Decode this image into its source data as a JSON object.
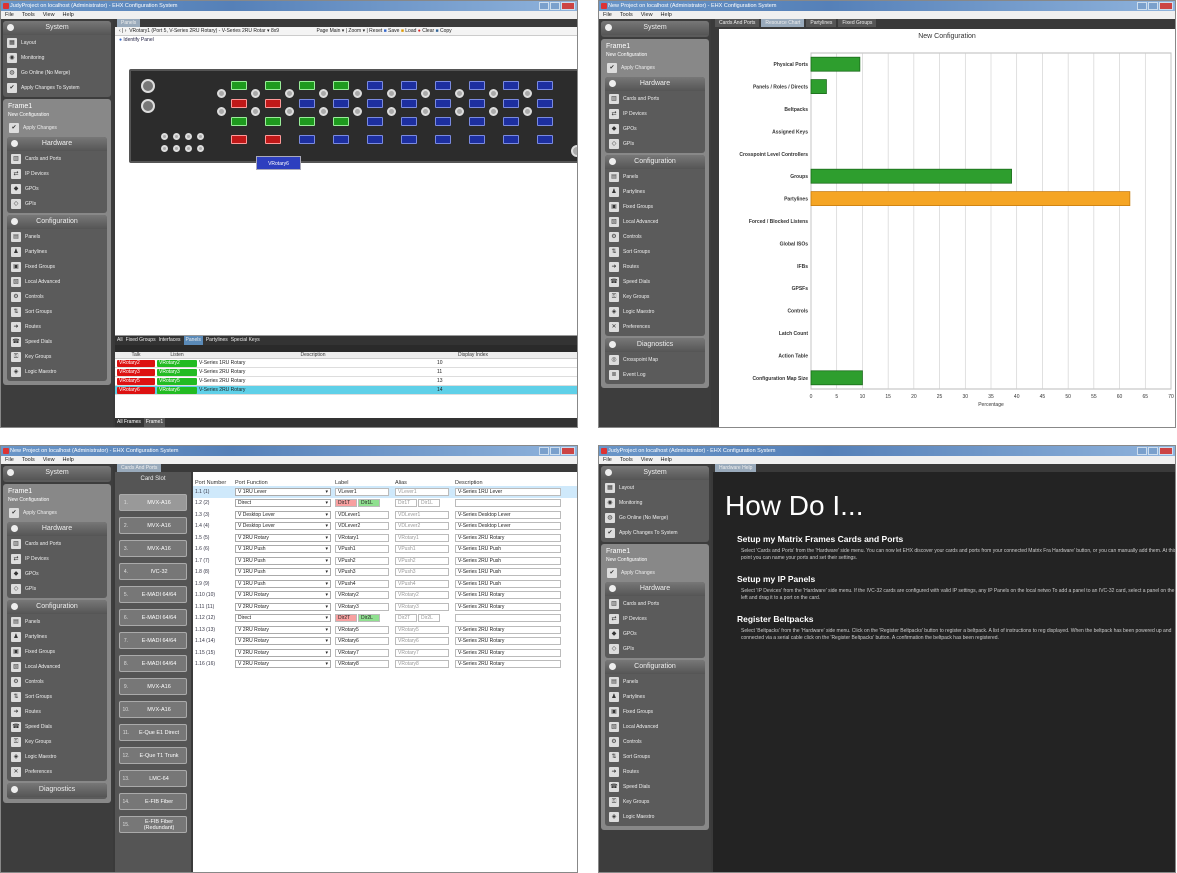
{
  "win1": {
    "title": "JudyProject on localhost (Administrator) - EHX Configuration System",
    "menu": [
      "File",
      "Tools",
      "View",
      "Help"
    ],
    "system": {
      "header": "System",
      "items": [
        "Layout",
        "Monitoring",
        "Go Online (No Merge)",
        "Apply Changes To System"
      ]
    },
    "frame": {
      "title": "Frame1",
      "subtitle": "New Configuration",
      "apply": "Apply Changes"
    },
    "hardware": {
      "header": "Hardware",
      "items": [
        "Cards and Ports",
        "IP Devices",
        "GPOs",
        "GPIs"
      ]
    },
    "configuration": {
      "header": "Configuration",
      "items": [
        "Panels",
        "Partylines",
        "Fixed Groups",
        "Local Advanced",
        "Controls",
        "Sort Groups",
        "Routes",
        "Speed Dials",
        "Key Groups",
        "Logic Maestro"
      ]
    },
    "tab": "Panels",
    "toolbar": {
      "combo": "VRotary1   (Port 5, V-Series 2RU Rotary)  - V-Series 2RU Rotar",
      "size": "8x9",
      "page": "Page Main",
      "zoom": "Zoom",
      "reset": "Reset",
      "save": "Save",
      "load": "Load",
      "clear": "Clear",
      "copy": "Copy"
    },
    "identify": "Identify Panel",
    "panel_label": "VRotary6",
    "grid": {
      "tabs": [
        "All",
        "Fixed Groups",
        "Interfaces",
        "Panels",
        "Partylines",
        "Special Keys"
      ],
      "active": "Panels",
      "headers": [
        "Talk",
        "Listen",
        "Description",
        "Display Index"
      ],
      "rows": [
        {
          "talk": "VRotary2",
          "listen": "VRotary2",
          "desc": "V-Series 1RU Rotary",
          "idx": "10"
        },
        {
          "talk": "VRotary3",
          "listen": "VRotary3",
          "desc": "V-Series 2RU Rotary",
          "idx": "11"
        },
        {
          "talk": "VRotary5",
          "listen": "VRotary5",
          "desc": "V-Series 2RU Rotary",
          "idx": "13"
        },
        {
          "talk": "VRotary6",
          "listen": "VRotary6",
          "desc": "V-Series 2RU Rotary",
          "idx": "14"
        }
      ]
    },
    "bottom": [
      "All Frames",
      "Frame1"
    ]
  },
  "win2": {
    "title": "New Project on localhost (Administrator) - EHX Configuration System",
    "menu": [
      "File",
      "Tools",
      "View",
      "Help"
    ],
    "system": {
      "header": "System"
    },
    "frame": {
      "title": "Frame1",
      "subtitle": "New Configuration",
      "apply": "Apply Changes"
    },
    "hardware": {
      "header": "Hardware",
      "items": [
        "Cards and Ports",
        "IP Devices",
        "GPOs",
        "GPIs"
      ]
    },
    "configuration": {
      "header": "Configuration",
      "items": [
        "Panels",
        "Partylines",
        "Fixed Groups",
        "Local Advanced",
        "Controls",
        "Sort Groups",
        "Routes",
        "Speed Dials",
        "Key Groups",
        "Logic Maestro",
        "Preferences"
      ]
    },
    "diagnostics": {
      "header": "Diagnostics",
      "items": [
        "Crosspoint Map",
        "Event Log"
      ]
    },
    "tabs": [
      "Cards And Ports",
      "Resource Chart",
      "Partylines",
      "Fixed Groups"
    ],
    "active_tab": "Resource Chart"
  },
  "chart_data": {
    "type": "bar",
    "orientation": "horizontal",
    "title": "New Configuration",
    "xlabel": "Percentage",
    "xlim": [
      0,
      70
    ],
    "xticks": [
      0,
      5,
      10,
      15,
      20,
      25,
      30,
      35,
      40,
      45,
      50,
      55,
      60,
      65,
      70
    ],
    "categories": [
      "Physical Ports",
      "Panels / Roles / Directs",
      "Beltpacks",
      "Assigned Keys",
      "Crosspoint Level Controllers",
      "Groups",
      "Partylines",
      "Forced / Blocked Listens",
      "Global ISOs",
      "IFBs",
      "GPSFs",
      "Controls",
      "Latch Count",
      "Action Table",
      "Configuration Map Size"
    ],
    "values": [
      9.5,
      3,
      0,
      0,
      0,
      39,
      62,
      0,
      0,
      0,
      0,
      0,
      0,
      0,
      10
    ],
    "colors": {
      "green": "#2e9e2e",
      "orange": "#f5a524"
    }
  },
  "win3": {
    "title": "New Project on localhost (Administrator) - EHX Configuration System",
    "menu": [
      "File",
      "Tools",
      "View",
      "Help"
    ],
    "system": {
      "header": "System"
    },
    "frame": {
      "title": "Frame1",
      "subtitle": "New Configuration",
      "apply": "Apply Changes"
    },
    "hardware": {
      "header": "Hardware",
      "items": [
        "Cards and Ports",
        "IP Devices",
        "GPOs",
        "GPIs"
      ]
    },
    "configuration": {
      "header": "Configuration",
      "items": [
        "Panels",
        "Partylines",
        "Fixed Groups",
        "Local Advanced",
        "Controls",
        "Sort Groups",
        "Routes",
        "Speed Dials",
        "Key Groups",
        "Logic Maestro",
        "Preferences"
      ]
    },
    "diagnostics": {
      "header": "Diagnostics"
    },
    "tab": "Cards And Ports",
    "card_slot_header": "Card Slot",
    "slots": [
      {
        "n": "1.",
        "l": "MVX-A16"
      },
      {
        "n": "2.",
        "l": "MVX-A16"
      },
      {
        "n": "3.",
        "l": "MVX-A16"
      },
      {
        "n": "4.",
        "l": "IVC-32"
      },
      {
        "n": "5.",
        "l": "E-MADI 64/64"
      },
      {
        "n": "6.",
        "l": "E-MADI 64/64"
      },
      {
        "n": "7.",
        "l": "E-MADI 64/64"
      },
      {
        "n": "8.",
        "l": "E-MADI 64/64"
      },
      {
        "n": "9.",
        "l": "MVX-A16"
      },
      {
        "n": "10.",
        "l": "MVX-A16"
      },
      {
        "n": "11.",
        "l": "E-Que E1 Direct"
      },
      {
        "n": "12.",
        "l": "E-Que T1 Trunk"
      },
      {
        "n": "13.",
        "l": "LMC-64"
      },
      {
        "n": "14.",
        "l": "E-FIB Fiber"
      },
      {
        "n": "15.",
        "l": "E-FIB Fiber (Redundant)"
      }
    ],
    "headers": [
      "Port Number",
      "Port Function",
      "Label",
      "Alias",
      "Description"
    ],
    "rows": [
      {
        "num": "1.1 (1)",
        "fn": "V 1RU Lever",
        "label": "VLever1",
        "alias": "VLever1",
        "desc": "V-Series 1RU Lever"
      },
      {
        "num": "1.2 (2)",
        "fn": "Direct",
        "label": "Dir1T",
        "label2": "Dir1L",
        "alias": "Dir1T",
        "alias2": "Dir1L",
        "desc": ""
      },
      {
        "num": "1.3 (3)",
        "fn": "V Desktop Lever",
        "label": "VDLever1",
        "alias": "VDLever1",
        "desc": "V-Series Desktop Lever"
      },
      {
        "num": "1.4 (4)",
        "fn": "V Desktop Lever",
        "label": "VDLever2",
        "alias": "VDLever2",
        "desc": "V-Series Desktop Lever"
      },
      {
        "num": "1.5 (5)",
        "fn": "V 2RU Rotary",
        "label": "VRotary1",
        "alias": "VRotary1",
        "desc": "V-Series 2RU Rotary"
      },
      {
        "num": "1.6 (6)",
        "fn": "V 1RU Push",
        "label": "VPush1",
        "alias": "VPush1",
        "desc": "V-Series 1RU Push"
      },
      {
        "num": "1.7 (7)",
        "fn": "V 1RU Push",
        "label": "VPush2",
        "alias": "VPush2",
        "desc": "V-Series 2RU Push"
      },
      {
        "num": "1.8 (8)",
        "fn": "V 1RU Push",
        "label": "VPush3",
        "alias": "VPush3",
        "desc": "V-Series 1RU Push"
      },
      {
        "num": "1.9 (9)",
        "fn": "V 1RU Push",
        "label": "VPush4",
        "alias": "VPush4",
        "desc": "V-Series 1RU Push"
      },
      {
        "num": "1.10 (10)",
        "fn": "V 1RU Rotary",
        "label": "VRotary2",
        "alias": "VRotary2",
        "desc": "V-Series 1RU Rotary"
      },
      {
        "num": "1.11 (11)",
        "fn": "V 2RU Rotary",
        "label": "VRotary3",
        "alias": "VRotary3",
        "desc": "V-Series 2RU Rotary"
      },
      {
        "num": "1.12 (12)",
        "fn": "Direct",
        "label": "Dir2T",
        "label2": "Dir2L",
        "alias": "Dir2T",
        "alias2": "Dir2L",
        "desc": ""
      },
      {
        "num": "1.13 (13)",
        "fn": "V 2RU Rotary",
        "label": "VRotary5",
        "alias": "VRotary5",
        "desc": "V-Series 2RU Rotary"
      },
      {
        "num": "1.14 (14)",
        "fn": "V 2RU Rotary",
        "label": "VRotary6",
        "alias": "VRotary6",
        "desc": "V-Series 2RU Rotary"
      },
      {
        "num": "1.15 (15)",
        "fn": "V 2RU Rotary",
        "label": "VRotary7",
        "alias": "VRotary7",
        "desc": "V-Series 2RU Rotary"
      },
      {
        "num": "1.16 (16)",
        "fn": "V 2RU Rotary",
        "label": "VRotary8",
        "alias": "VRotary8",
        "desc": "V-Series 2RU Rotary"
      }
    ]
  },
  "win4": {
    "title": "JudyProject on localhost (Administrator) - EHX Configuration System",
    "menu": [
      "File",
      "Tools",
      "View",
      "Help"
    ],
    "system": {
      "header": "System",
      "items": [
        "Layout",
        "Monitoring",
        "Go Online (No Merge)",
        "Apply Changes To System"
      ]
    },
    "frame": {
      "title": "Frame1",
      "subtitle": "New Configuration",
      "apply": "Apply Changes"
    },
    "hardware": {
      "header": "Hardware",
      "items": [
        "Cards and Ports",
        "IP Devices",
        "GPOs",
        "GPIs"
      ]
    },
    "configuration": {
      "header": "Configuration",
      "items": [
        "Panels",
        "Partylines",
        "Fixed Groups",
        "Local Advanced",
        "Controls",
        "Sort Groups",
        "Routes",
        "Speed Dials",
        "Key Groups",
        "Logic Maestro"
      ]
    },
    "tab": "Hardware Help",
    "help": {
      "title": "How Do I...",
      "sections": [
        {
          "h": "Setup my Matrix Frames Cards and Ports",
          "p": "Select 'Cards and Ports' from the 'Hardware' side menu. You can now let EHX discover your cards and ports from your connected Matrix Fra Hardware' button, or you can manually add them. At this point you can name your ports and set their settings."
        },
        {
          "h": "Setup my IP Panels",
          "p": "Select 'IP Devices' from the 'Hardware' side menu. If the IVC-32 cards are configured with valid IP settings, any IP Panels on the local netwo To add a panel to an IVC-32 card, select a panel on the left and drag it to a port on the card."
        },
        {
          "h": "Register Beltpacks",
          "p": "Select 'Beltpacks' from the 'Hardware' side menu. Click on the 'Register Beltpacks' button to register a beltpack. A list of instructions to reg displayed. When the beltpack has been powered up and connected via a serial cable click on the 'Register Beltpacks' button. A confirmation the beltpack has been registered."
        }
      ]
    }
  }
}
